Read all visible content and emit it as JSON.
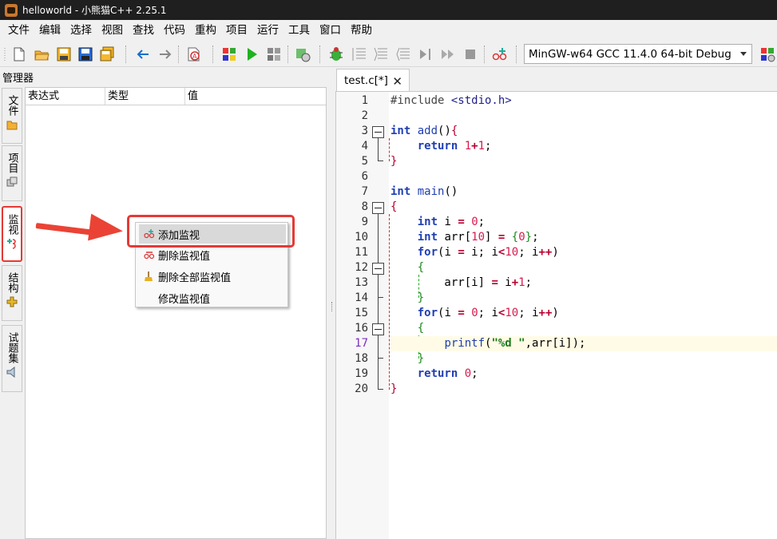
{
  "window": {
    "title": "helloworld - 小熊猫C++ 2.25.1"
  },
  "menubar": {
    "items": [
      "文件",
      "编辑",
      "选择",
      "视图",
      "查找",
      "代码",
      "重构",
      "项目",
      "运行",
      "工具",
      "窗口",
      "帮助"
    ]
  },
  "toolbar": {
    "compiler": "MinGW-w64 GCC 11.4.0 64-bit Debug",
    "icons": [
      "new-file-icon",
      "open-folder-icon",
      "save-icon",
      "save-as-icon",
      "save-all-icon",
      "undo-icon",
      "redo-icon",
      "format-icon",
      "compile-icon",
      "run-icon",
      "compile-run-icon",
      "rebuild-icon",
      "debug-icon",
      "step-over-icon",
      "step-into-icon",
      "step-out-icon",
      "run-to-cursor-icon",
      "continue-icon",
      "stop-icon",
      "add-watch-icon",
      "options-icon"
    ]
  },
  "left_panel": {
    "title": "管理器",
    "vtabs": [
      {
        "label": "文件",
        "icon": "folder-icon"
      },
      {
        "label": "项目",
        "icon": "project-icon"
      },
      {
        "label": "监视",
        "icon": "watch-icon",
        "active": true
      },
      {
        "label": "结构",
        "icon": "structure-icon"
      },
      {
        "label": "试题集",
        "icon": "problem-set-icon"
      }
    ],
    "watch_columns": [
      "表达式",
      "类型",
      "值"
    ]
  },
  "context_menu": {
    "items": [
      {
        "label": "添加监视",
        "icon": "add-watch-icon",
        "highlighted": true
      },
      {
        "label": "删除监视值",
        "icon": "remove-watch-icon"
      },
      {
        "label": "删除全部监视值",
        "icon": "broom-icon"
      },
      {
        "label": "修改监视值",
        "icon": ""
      }
    ]
  },
  "editor": {
    "tab_label": "test.c[*]",
    "current_line": 17,
    "line_numbers": [
      "1",
      "2",
      "3",
      "4",
      "5",
      "6",
      "7",
      "8",
      "9",
      "10",
      "11",
      "12",
      "13",
      "14",
      "15",
      "16",
      "17",
      "18",
      "19",
      "20"
    ],
    "lines": [
      "#include <stdio.h>",
      "",
      "int add(){",
      "    return 1+1;",
      "}",
      "",
      "int main()",
      "{",
      "    int i = 0;",
      "    int arr[10] = {0};",
      "    for(i = i; i<10; i++)",
      "    {",
      "        arr[i] = i+1;",
      "    }",
      "    for(i = 0; i<10; i++)",
      "    {",
      "        printf(\"%d \",arr[i]);",
      "    }",
      "    return 0;",
      "}"
    ]
  }
}
